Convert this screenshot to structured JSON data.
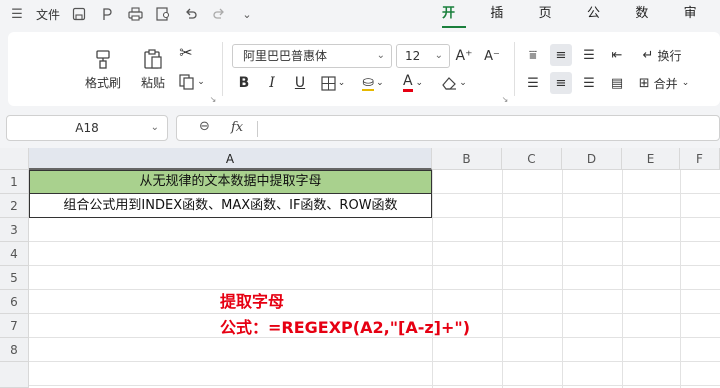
{
  "menu": {
    "file_label": "文件",
    "tabs": [
      "开始",
      "插入",
      "页面",
      "公式",
      "数据",
      "审阅"
    ],
    "active_tab": "开始"
  },
  "ribbon": {
    "format_painter_label": "格式刷",
    "paste_label": "粘贴",
    "font_name": "阿里巴巴普惠体",
    "font_size": "12",
    "wrap_label": "换行",
    "merge_label": "合并",
    "bold_glyph": "B",
    "italic_glyph": "I",
    "underline_glyph": "U",
    "font_color_glyph": "A",
    "grow_font_glyph": "A⁺",
    "shrink_font_glyph": "A⁻",
    "font_color_hex": "#e60012"
  },
  "formula_bar": {
    "cell_ref": "A18",
    "fx_label": "fx",
    "formula": ""
  },
  "sheet": {
    "columns": [
      "A",
      "B",
      "C",
      "D",
      "E",
      "F"
    ],
    "rows": [
      "1",
      "2",
      "3",
      "4",
      "5",
      "6",
      "7",
      "8"
    ],
    "cells": {
      "A1": "从无规律的文本数据中提取字母",
      "A2": "组合公式用到INDEX函数、MAX函数、IF函数、ROW函数"
    },
    "header_fill_hex": "#a9d18e"
  },
  "annotation": {
    "title": "提取字母",
    "formula": "公式：=REGEXP(A2,\"[A-z]+\")",
    "color_hex": "#e60012"
  }
}
